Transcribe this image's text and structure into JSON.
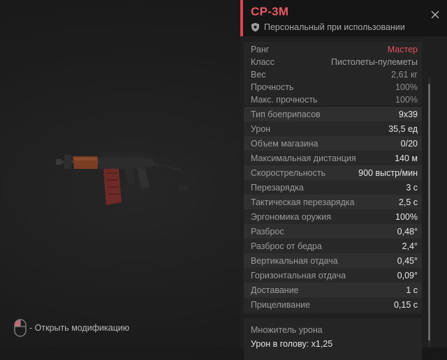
{
  "viewer": {
    "hint_text": "- Открыть модификацию"
  },
  "item": {
    "title": "СР-3М",
    "binding": "Персональный при использовании"
  },
  "info_rows": [
    {
      "label": "Ранг",
      "value": "Мастер"
    },
    {
      "label": "Класс",
      "value": "Пистолеты-пулеметы"
    },
    {
      "label": "Вес",
      "value": "2,61 кг"
    },
    {
      "label": "Прочность",
      "value": "100%"
    },
    {
      "label": "Макс. прочность",
      "value": "100%"
    }
  ],
  "stat_rows": [
    {
      "label": "Тип боеприпасов",
      "value": "9x39"
    },
    {
      "label": "Урон",
      "value": "35,5 ед"
    },
    {
      "label": "Объем магазина",
      "value": "0/20"
    },
    {
      "label": "Максимальная дистанция",
      "value": "140 м"
    },
    {
      "label": "Скорострельность",
      "value": "900 выстр/мин"
    },
    {
      "label": "Перезарядка",
      "value": "3 с"
    },
    {
      "label": "Тактическая перезарядка",
      "value": "2,5 с"
    },
    {
      "label": "Эргономика оружия",
      "value": "100%"
    },
    {
      "label": "Разброс",
      "value": "0,48°"
    },
    {
      "label": "Разброс от бедра",
      "value": "2,4°"
    },
    {
      "label": "Вертикальная отдача",
      "value": "0,45°"
    },
    {
      "label": "Горизонтальная отдача",
      "value": "0,09°"
    },
    {
      "label": "Доставание",
      "value": "1 с"
    },
    {
      "label": "Прицеливание",
      "value": "0,15 с"
    }
  ],
  "damage": {
    "heading": "Множитель урона",
    "headshot": "Урон в голову: x1,25"
  },
  "colors": {
    "accent": "#e0434f",
    "rank": "#e4505d",
    "weapon_wood": "#7a3e24"
  },
  "icons": {
    "close": "close-icon",
    "binding": "shield-icon",
    "hint": "mouse-icon"
  }
}
